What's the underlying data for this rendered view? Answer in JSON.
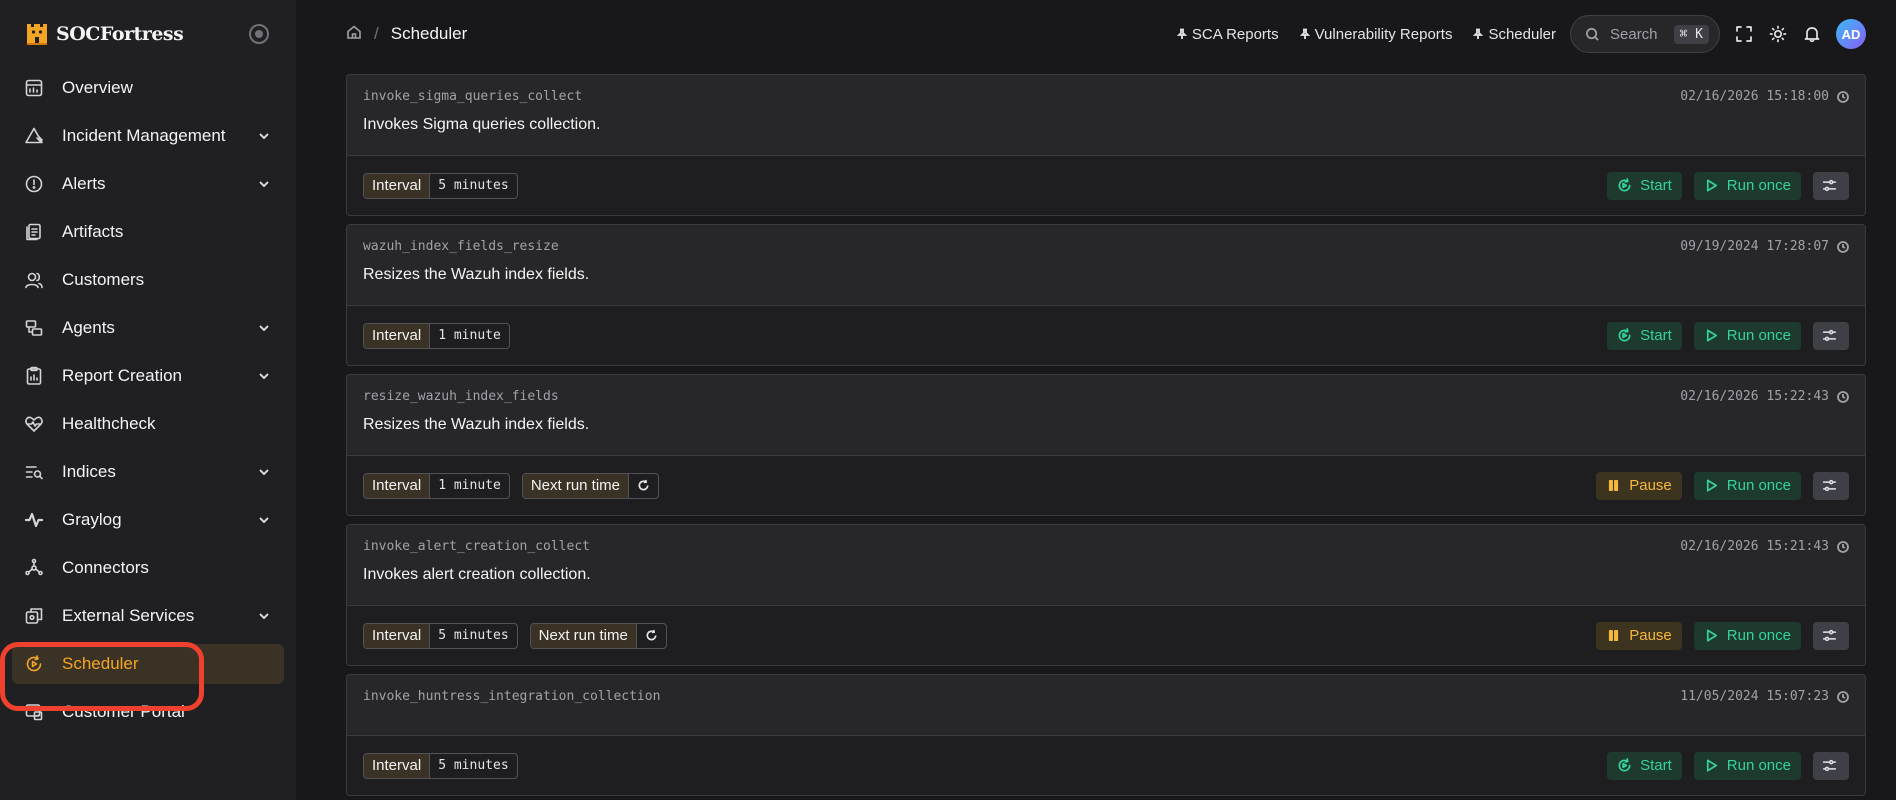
{
  "brand": {
    "name": "SOCFortress",
    "accent": "#f5a524"
  },
  "sidebar": {
    "items": [
      {
        "label": "Overview",
        "icon": "dashboard-icon",
        "expandable": false
      },
      {
        "label": "Incident Management",
        "icon": "warning-triangle-icon",
        "expandable": true
      },
      {
        "label": "Alerts",
        "icon": "alert-circle-icon",
        "expandable": true
      },
      {
        "label": "Artifacts",
        "icon": "documents-icon",
        "expandable": false
      },
      {
        "label": "Customers",
        "icon": "users-icon",
        "expandable": false
      },
      {
        "label": "Agents",
        "icon": "agents-icon",
        "expandable": true
      },
      {
        "label": "Report Creation",
        "icon": "report-icon",
        "expandable": true
      },
      {
        "label": "Healthcheck",
        "icon": "heart-pulse-icon",
        "expandable": false
      },
      {
        "label": "Indices",
        "icon": "list-search-icon",
        "expandable": true
      },
      {
        "label": "Graylog",
        "icon": "pulse-icon",
        "expandable": true
      },
      {
        "label": "Connectors",
        "icon": "connectors-icon",
        "expandable": false
      },
      {
        "label": "External Services",
        "icon": "external-services-icon",
        "expandable": true
      },
      {
        "label": "Scheduler",
        "icon": "scheduler-icon",
        "expandable": false,
        "active": true
      },
      {
        "label": "Customer Portal",
        "icon": "portal-icon",
        "expandable": false
      }
    ]
  },
  "topbar": {
    "breadcrumb": "Scheduler",
    "pinned": [
      "SCA Reports",
      "Vulnerability Reports",
      "Scheduler"
    ],
    "search_placeholder": "Search",
    "search_shortcut": "⌘ K",
    "avatar_initials": "AD"
  },
  "jobs": [
    {
      "id": "invoke_sigma_queries_collect",
      "description": "Invokes Sigma queries collection.",
      "date": "02/16/2026 15:18:00",
      "interval_label": "Interval",
      "interval": "5 minutes",
      "next_run": null,
      "state_action": "Start",
      "run_once": "Run once"
    },
    {
      "id": "wazuh_index_fields_resize",
      "description": "Resizes the Wazuh index fields.",
      "date": "09/19/2024 17:28:07",
      "interval_label": "Interval",
      "interval": "1 minute",
      "next_run": null,
      "state_action": "Start",
      "run_once": "Run once"
    },
    {
      "id": "resize_wazuh_index_fields",
      "description": "Resizes the Wazuh index fields.",
      "date": "02/16/2026 15:22:43",
      "interval_label": "Interval",
      "interval": "1 minute",
      "next_run": "Next run time",
      "state_action": "Pause",
      "run_once": "Run once"
    },
    {
      "id": "invoke_alert_creation_collect",
      "description": "Invokes alert creation collection.",
      "date": "02/16/2026 15:21:43",
      "interval_label": "Interval",
      "interval": "5 minutes",
      "next_run": "Next run time",
      "state_action": "Pause",
      "run_once": "Run once"
    },
    {
      "id": "invoke_huntress_integration_collection",
      "description": "",
      "date": "11/05/2024 15:07:23",
      "interval_label": "Interval",
      "interval": "5 minutes",
      "next_run": null,
      "state_action": "Start",
      "run_once": "Run once"
    }
  ]
}
